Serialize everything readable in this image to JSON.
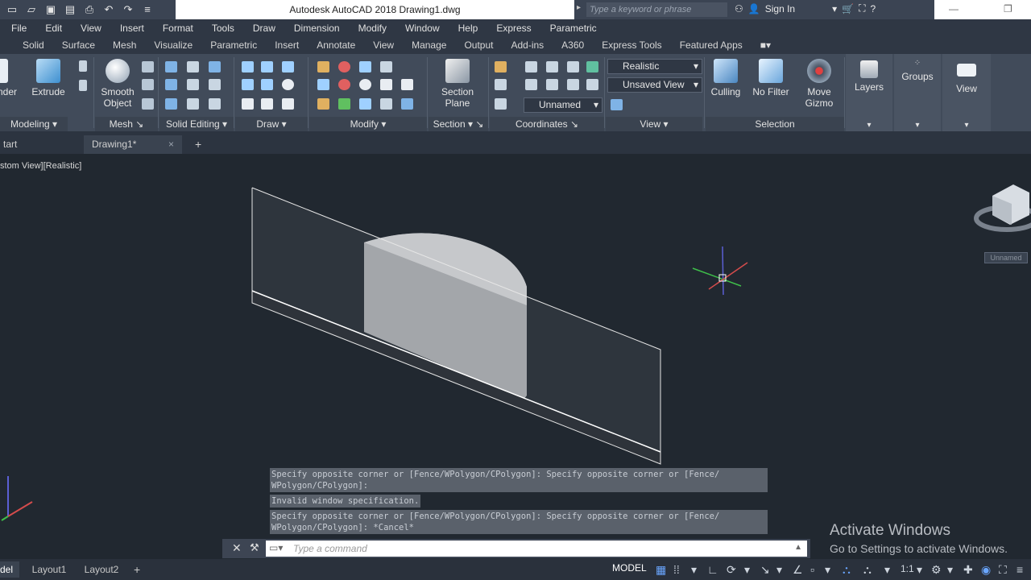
{
  "title": {
    "app_title": "Autodesk AutoCAD 2018    Drawing1.dwg"
  },
  "search": {
    "placeholder": "Type a keyword or phrase"
  },
  "account": {
    "signin": "Sign In"
  },
  "menu": [
    "File",
    "Edit",
    "View",
    "Insert",
    "Format",
    "Tools",
    "Draw",
    "Dimension",
    "Modify",
    "Window",
    "Help",
    "Express",
    "Parametric"
  ],
  "ribbon_tabs": [
    "Solid",
    "Surface",
    "Mesh",
    "Visualize",
    "Parametric",
    "Insert",
    "Annotate",
    "View",
    "Manage",
    "Output",
    "Add-ins",
    "A360",
    "Express Tools",
    "Featured Apps"
  ],
  "ribbon": {
    "cylinder_partial": "nder",
    "extrude": "Extrude",
    "smooth_object": "Smooth Object",
    "section_plane": "Section Plane",
    "visual_style": "Realistic",
    "saved_view": "Unsaved View",
    "ucs": "Unnamed",
    "culling": "Culling",
    "no_filter": "No Filter",
    "move_gizmo": "Move Gizmo",
    "layers": "Layers",
    "groups": "Groups",
    "view": "View",
    "panels": {
      "modeling": "Modeling",
      "mesh": "Mesh",
      "solid_editing": "Solid Editing",
      "draw": "Draw",
      "modify": "Modify",
      "section": "Section",
      "coordinates": "Coordinates",
      "view": "View",
      "selection": "Selection"
    }
  },
  "file_tabs": {
    "start_partial": "tart",
    "drawing": "Drawing1*"
  },
  "viewport": {
    "label": "stom View][Realistic]",
    "viewcube_label": "Unnamed"
  },
  "command": {
    "history": [
      "Specify opposite corner or [Fence/WPolygon/CPolygon]: Specify opposite corner or [Fence/\nWPolygon/CPolygon]:",
      "Invalid window specification.",
      "Specify opposite corner or [Fence/WPolygon/CPolygon]: Specify opposite corner or [Fence/\nWPolygon/CPolygon]: *Cancel*"
    ],
    "placeholder": "Type  a  command"
  },
  "layout_tabs": {
    "model_partial": "del",
    "layout1": "Layout1",
    "layout2": "Layout2"
  },
  "status": {
    "model": "MODEL",
    "scale": "1:1"
  },
  "activation": {
    "title": "Activate Windows",
    "subtitle": "Go to Settings to activate Windows."
  }
}
